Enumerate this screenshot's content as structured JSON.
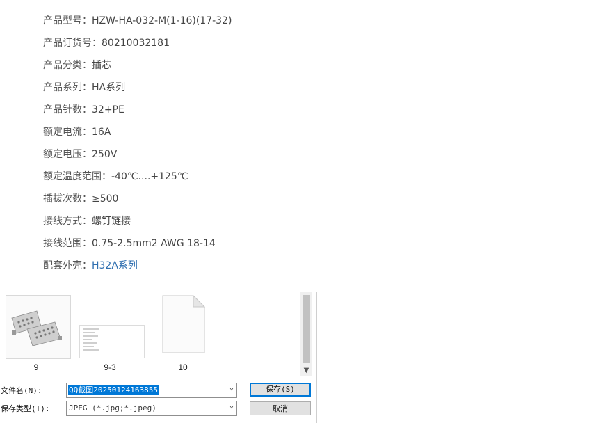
{
  "specs": [
    {
      "label": "产品型号：",
      "value": "HZW-HA-032-M(1-16)(17-32)"
    },
    {
      "label": "产品订货号：",
      "value": "80210032181"
    },
    {
      "label": "产品分类：",
      "value": "插芯"
    },
    {
      "label": "产品系列：",
      "value": "HA系列"
    },
    {
      "label": "产品针数：",
      "value": "32+PE"
    },
    {
      "label": "额定电流：",
      "value": "16A"
    },
    {
      "label": "额定电压：",
      "value": "250V"
    },
    {
      "label": "额定温度范围：",
      "value": "-40℃....+125℃"
    },
    {
      "label": "插拔次数：",
      "value": "≥500"
    },
    {
      "label": "接线方式：",
      "value": "螺钉链接"
    },
    {
      "label": "接线范围：",
      "value": "0.75-2.5mm2 AWG 18-14"
    },
    {
      "label": "配套外壳：",
      "value": "H32A系列",
      "link": true
    }
  ],
  "dialog": {
    "files": [
      {
        "name": "9",
        "type": "image"
      },
      {
        "name": "9-3",
        "type": "image"
      },
      {
        "name": "10",
        "type": "blank-document"
      }
    ],
    "filename_label": "文件名(N):",
    "filename_value": "QQ截图20250124163855",
    "filetype_label": "保存类型(T):",
    "filetype_value": "JPEG (*.jpg;*.jpeg)",
    "save_button": "保存(S)",
    "cancel_button": "取消",
    "colors": {
      "accent": "#0078d7",
      "link": "#2f6fb0"
    }
  }
}
